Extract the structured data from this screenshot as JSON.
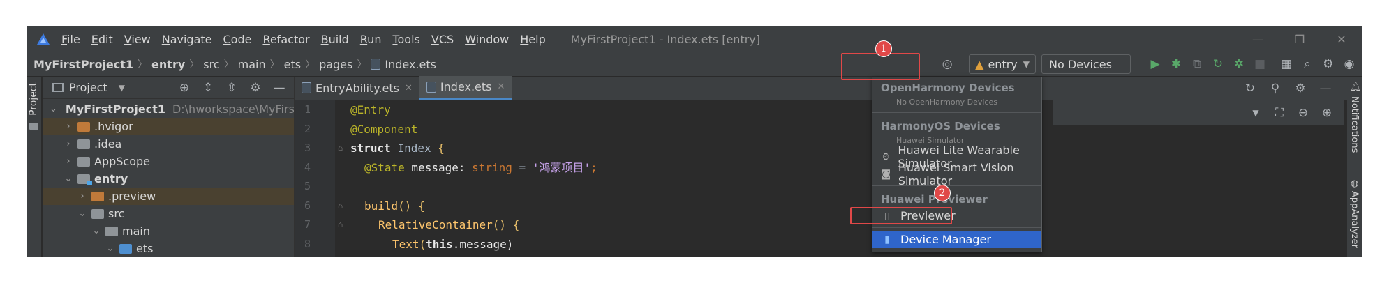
{
  "menubar": {
    "items": [
      {
        "mnemonic": "F",
        "rest": "ile"
      },
      {
        "mnemonic": "E",
        "rest": "dit"
      },
      {
        "mnemonic": "V",
        "rest": "iew"
      },
      {
        "mnemonic": "N",
        "rest": "avigate"
      },
      {
        "mnemonic": "C",
        "rest": "ode"
      },
      {
        "mnemonic": "R",
        "rest": "efactor"
      },
      {
        "mnemonic": "B",
        "rest": "uild"
      },
      {
        "mnemonic": "R",
        "rest": "un"
      },
      {
        "mnemonic": "T",
        "rest": "ools"
      },
      {
        "mnemonic": "V",
        "rest": "CS"
      },
      {
        "mnemonic": "W",
        "rest": "indow"
      },
      {
        "mnemonic": "H",
        "rest": "elp"
      }
    ],
    "title": "MyFirstProject1 - Index.ets [entry]"
  },
  "breadcrumb": [
    "MyFirstProject1",
    "entry",
    "src",
    "main",
    "ets",
    "pages",
    "Index.ets"
  ],
  "toolbar": {
    "module": "entry",
    "device": "No Devices",
    "badge1": "1",
    "badge2": "2"
  },
  "left_strip": {
    "label": "Project"
  },
  "project_panel": {
    "title": "Project",
    "tree": [
      {
        "name": "MyFirstProject1",
        "path": "D:\\hworkspace\\MyFirstPr"
      },
      {
        "name": ".hvigor"
      },
      {
        "name": ".idea"
      },
      {
        "name": "AppScope"
      },
      {
        "name": "entry"
      },
      {
        "name": ".preview"
      },
      {
        "name": "src"
      },
      {
        "name": "main"
      },
      {
        "name": "ets"
      }
    ]
  },
  "tabs": [
    {
      "label": "EntryAbility.ets"
    },
    {
      "label": "Index.ets"
    }
  ],
  "editor": {
    "line_numbers": [
      "1",
      "2",
      "3",
      "4",
      "5",
      "6",
      "7",
      "8"
    ],
    "code": {
      "l1": "@Entry",
      "l2": "@Component",
      "l3_kw": "struct",
      "l3_name": "Index",
      "l3_brace": " {",
      "l4_ann": "@State",
      "l4_var": " message: ",
      "l4_type": "string",
      "l4_eq": " = ",
      "l4_str": "'鸿蒙项目'",
      "l4_end": ";",
      "l6_fn": "build",
      "l6_rest": "() {",
      "l7_fn": "RelativeContainer",
      "l7_rest": "() {",
      "l8_fn": "Text",
      "l8_open": "(",
      "l8_this": "this",
      "l8_rest": ".message)"
    }
  },
  "dropdown": {
    "group1": "OpenHarmony Devices",
    "group1_sub": "No OpenHarmony Devices",
    "group2": "HarmonyOS Devices",
    "group2_sub": "Huawei Simulator",
    "item_wearable": "Huawei Lite Wearable Simulator",
    "item_vision": "Huawei Smart Vision Simulator",
    "group3": "Huawei Previewer",
    "item_previewer": "Previewer",
    "item_device_manager": "Device Manager"
  },
  "right_strip": {
    "notifications": "Notifications",
    "analyzer": "AppAnalyzer"
  },
  "colors": {
    "accent": "#2f65ca",
    "highlight_red": "#e04848",
    "background": "#2b2b2b"
  }
}
